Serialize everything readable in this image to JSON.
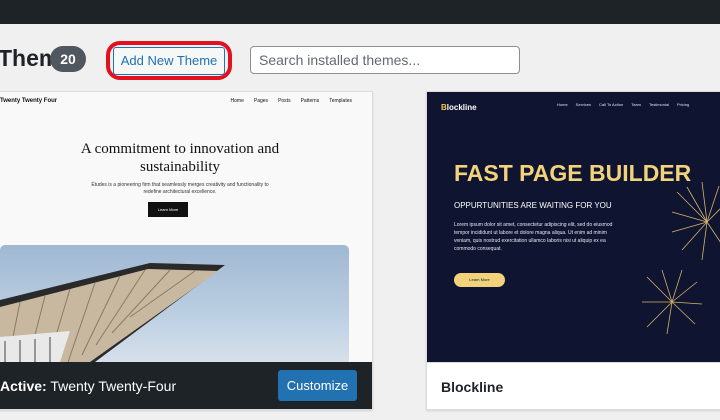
{
  "header": {
    "title": "Themes",
    "count": "20",
    "add_new_label": "Add New Theme",
    "search_placeholder": "Search installed themes..."
  },
  "themes": [
    {
      "name": "Twenty Twenty-Four",
      "active_prefix": "Active:",
      "customize_label": "Customize",
      "preview": {
        "site_title": "Twenty Twenty Four",
        "nav": [
          "Home",
          "Pages",
          "Posts",
          "Patterns",
          "Templates"
        ],
        "heading": "A commitment to innovation and sustainability",
        "body": "Études is a pioneering firm that seamlessly merges creativity and functionality to redefine architectural excellence.",
        "button": "Learn More"
      }
    },
    {
      "name": "Blockline",
      "preview": {
        "logo_initial": "B",
        "logo_rest": "lockline",
        "nav": [
          "Home",
          "Services",
          "Call To Action",
          "Team",
          "Testimonial",
          "Pricing"
        ],
        "heading": "FAST PAGE BUILDER",
        "subheading": "OPPURTUNITIES ARE WAITING FOR YOU",
        "body": "Lorem ipsum dolor sit amet, consectetur adipiscing elit, sed do eiusmod tempor incididunt ut labore et dolore magna aliqua. Ut enim ad minim veniam, quis nostrud exercitation ullamco laboris nisi ut aliquip ex ea commodo consequat.",
        "button": "Learn More"
      }
    }
  ],
  "colors": {
    "admin_bar": "#1d2327",
    "primary_blue": "#2271b1",
    "highlight_ring": "#e3101e",
    "blockline_bg": "#0f1530",
    "blockline_accent": "#f2d27a"
  }
}
